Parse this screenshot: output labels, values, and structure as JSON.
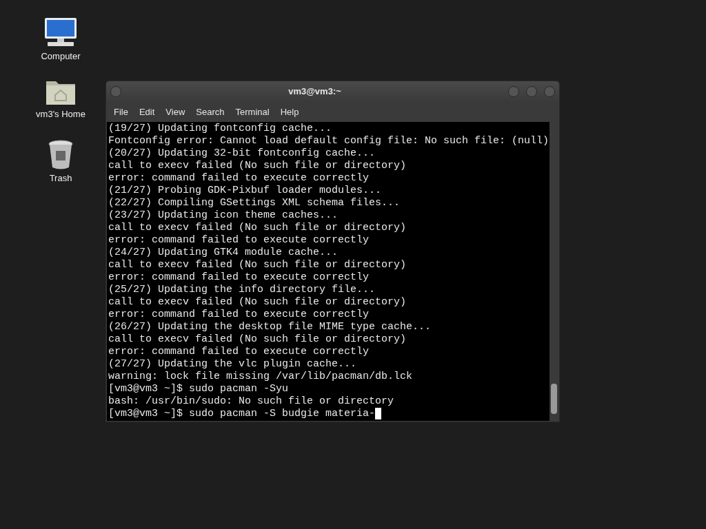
{
  "desktop_icons": [
    {
      "kind": "computer",
      "label": "Computer"
    },
    {
      "kind": "home",
      "label": "vm3's Home"
    },
    {
      "kind": "trash",
      "label": "Trash"
    }
  ],
  "window": {
    "title": "vm3@vm3:~"
  },
  "menu": [
    "File",
    "Edit",
    "View",
    "Search",
    "Terminal",
    "Help"
  ],
  "terminal": {
    "lines": [
      "(19/27) Updating fontconfig cache...",
      "Fontconfig error: Cannot load default config file: No such file: (null)",
      "(20/27) Updating 32-bit fontconfig cache...",
      "call to execv failed (No such file or directory)",
      "error: command failed to execute correctly",
      "(21/27) Probing GDK-Pixbuf loader modules...",
      "(22/27) Compiling GSettings XML schema files...",
      "(23/27) Updating icon theme caches...",
      "call to execv failed (No such file or directory)",
      "error: command failed to execute correctly",
      "(24/27) Updating GTK4 module cache...",
      "call to execv failed (No such file or directory)",
      "error: command failed to execute correctly",
      "(25/27) Updating the info directory file...",
      "call to execv failed (No such file or directory)",
      "error: command failed to execute correctly",
      "(26/27) Updating the desktop file MIME type cache...",
      "call to execv failed (No such file or directory)",
      "error: command failed to execute correctly",
      "(27/27) Updating the vlc plugin cache...",
      "warning: lock file missing /var/lib/pacman/db.lck",
      "[vm3@vm3 ~]$ sudo pacman -Syu",
      "bash: /usr/bin/sudo: No such file or directory",
      "[vm3@vm3 ~]$ sudo pacman -S budgie materia-"
    ]
  }
}
